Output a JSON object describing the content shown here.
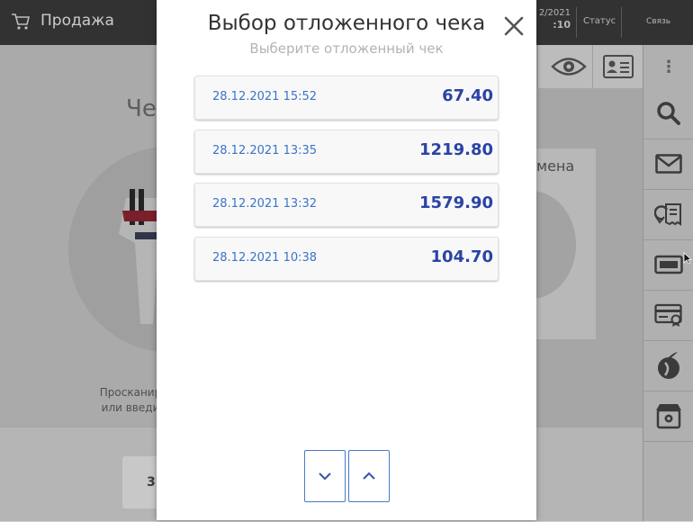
{
  "app": {
    "title": "Продажа",
    "date_top": "2/2021",
    "date_bottom": ":10",
    "status_label": "Статус",
    "link_label": "Связь",
    "bg_heading": "Че",
    "bg_panel_title": "мена",
    "bg_hint": "Просканир или введи",
    "bg_key_label": "3"
  },
  "modal": {
    "title": "Выбор отложенного чека",
    "subtitle": "Выберите отложенный чек",
    "close_icon": "close-icon",
    "rows": [
      {
        "date": "28.12.2021 15:52",
        "amount": "67.40"
      },
      {
        "date": "28.12.2021 13:35",
        "amount": "1219.80"
      },
      {
        "date": "28.12.2021 13:32",
        "amount": "1579.90"
      },
      {
        "date": "28.12.2021 10:38",
        "amount": "104.70"
      }
    ],
    "nav_icons": [
      "chevron-down-icon",
      "chevron-up-icon"
    ]
  },
  "colors": {
    "accent": "#3b74c9",
    "amount": "#2b43a5",
    "topbar": "#3a3a3a"
  }
}
